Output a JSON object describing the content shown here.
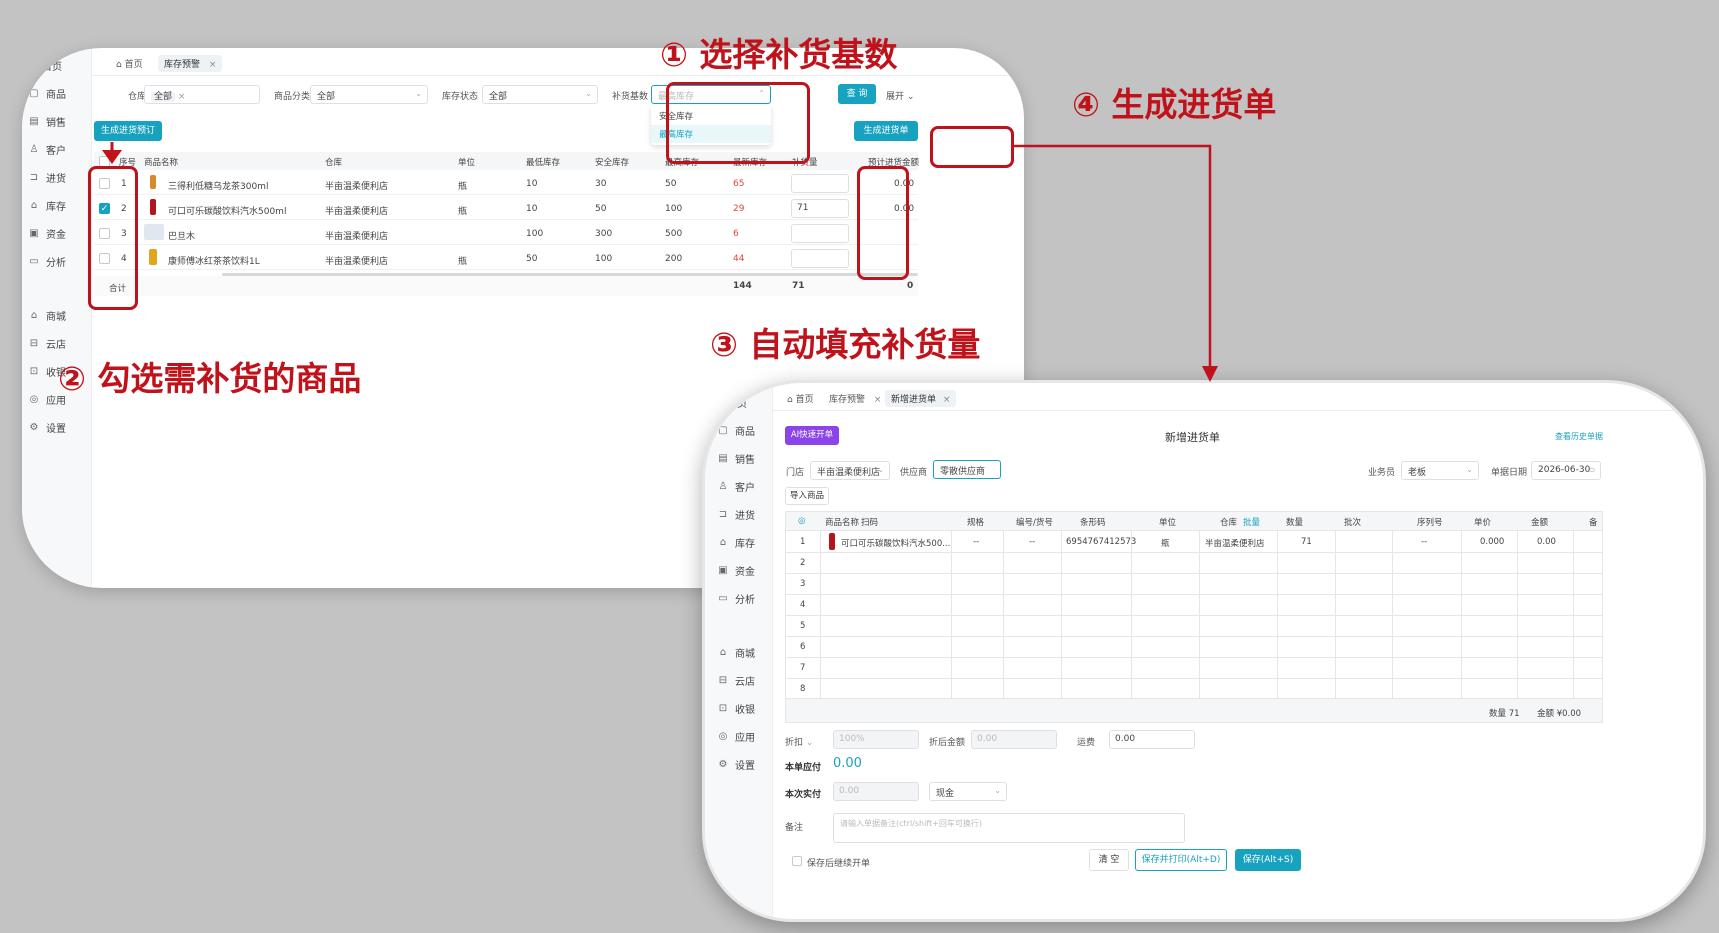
{
  "annotations": {
    "step1": "① 选择补货基数",
    "step2": "② 勾选需补货的商品",
    "step3": "③ 自动填充补货量",
    "step4": "④ 生成进货单"
  },
  "colors": {
    "accent": "#17a2c0",
    "annotation": "#c0121a",
    "warning": "#e0463a",
    "ai_button": "#8a44e8"
  },
  "sidebar": {
    "items": [
      {
        "label": "首页",
        "icon": "home-icon"
      },
      {
        "label": "商品",
        "icon": "box-icon"
      },
      {
        "label": "销售",
        "icon": "receipt-icon"
      },
      {
        "label": "客户",
        "icon": "user-icon"
      },
      {
        "label": "进货",
        "icon": "cart-icon"
      },
      {
        "label": "库存",
        "icon": "warehouse-icon"
      },
      {
        "label": "资金",
        "icon": "wallet-icon"
      },
      {
        "label": "分析",
        "icon": "chart-icon"
      },
      {
        "label": "商城",
        "icon": "shop-icon"
      },
      {
        "label": "云店",
        "icon": "cloud-store-icon"
      },
      {
        "label": "收银",
        "icon": "cashier-icon"
      },
      {
        "label": "应用",
        "icon": "apps-icon"
      },
      {
        "label": "设置",
        "icon": "gear-icon"
      }
    ]
  },
  "win1": {
    "tabs": [
      {
        "label": "首页"
      },
      {
        "label": "库存预警"
      }
    ],
    "filters": {
      "warehouse_label": "仓库",
      "warehouse_tag": "全部",
      "category_label": "商品分类",
      "category_value": "全部",
      "status_label": "库存状态",
      "status_value": "全部",
      "base_label": "补货基数",
      "base_placeholder": "最高库存",
      "base_options": [
        "安全库存",
        "最高库存"
      ],
      "query_btn": "查 询",
      "expand_btn": "展开"
    },
    "gen_forecast_btn": "生成进货预订",
    "gen_order_btn": "生成进货单",
    "columns": [
      "序号",
      "商品名称",
      "仓库",
      "单位",
      "最低库存",
      "安全库存",
      "最高库存",
      "最新库存",
      "补货量",
      "预计进货金额"
    ],
    "rows": [
      {
        "no": "1",
        "name": "三得利低糖乌龙茶300ml",
        "warehouse": "半亩温柔便利店",
        "unit": "瓶",
        "min": "10",
        "safe": "30",
        "max": "50",
        "stock": "65",
        "qty": "",
        "amount": "0.00"
      },
      {
        "no": "2",
        "name": "可口可乐碳酸饮料汽水500ml",
        "warehouse": "半亩温柔便利店",
        "unit": "瓶",
        "min": "10",
        "safe": "50",
        "max": "100",
        "stock": "29",
        "qty": "71",
        "amount": "0.00"
      },
      {
        "no": "3",
        "name": "巴旦木",
        "warehouse": "半亩温柔便利店",
        "unit": "",
        "min": "100",
        "safe": "300",
        "max": "500",
        "stock": "6",
        "qty": "",
        "amount": ""
      },
      {
        "no": "4",
        "name": "康师傅冰红茶茶饮料1L",
        "warehouse": "半亩温柔便利店",
        "unit": "瓶",
        "min": "50",
        "safe": "100",
        "max": "200",
        "stock": "44",
        "qty": "",
        "amount": ""
      }
    ],
    "total_label": "合计",
    "totals": {
      "stock": "144",
      "qty": "71",
      "amount": "0"
    }
  },
  "win2": {
    "tabs": [
      {
        "label": "首页"
      },
      {
        "label": "库存预警"
      },
      {
        "label": "新增进货单"
      }
    ],
    "ai_btn": "AI快速开单",
    "title": "新增进货单",
    "history_link": "查看历史单据",
    "store_label": "门店",
    "store_value": "半亩温柔便利店",
    "supplier_label": "供应商",
    "supplier_value": "零散供应商",
    "clerk_label": "业务员",
    "clerk_value": "老板",
    "date_label": "单据日期",
    "date_value": "2026-06-30",
    "import_btn": "导入商品",
    "columns": [
      "商品名称",
      "扫码",
      "规格",
      "编号/货号",
      "条形码",
      "单位",
      "仓库",
      "批量",
      "数量",
      "批次",
      "序列号",
      "单价",
      "金额",
      "备"
    ],
    "row": {
      "no": "1",
      "name": "可口可乐碳酸饮料汽水500...",
      "spec": "--",
      "code": "--",
      "barcode": "6954767412573",
      "unit": "瓶",
      "warehouse": "半亩温柔便利店",
      "qty": "71",
      "serial": "--",
      "price": "0.000",
      "amount": "0.00"
    },
    "row_numbers": [
      "2",
      "3",
      "4",
      "5",
      "6",
      "7",
      "8"
    ],
    "summary_qty": "数量 71",
    "summary_amount": "金额 ¥0.00",
    "discount_label": "折扣",
    "discount_value": "100%",
    "after_discount_label": "折后金额",
    "after_discount_value": "0.00",
    "freight_label": "运费",
    "freight_value": "0.00",
    "payable_label": "本单应付",
    "payable_value": "0.00",
    "paid_label": "本次实付",
    "paid_value": "0.00",
    "pay_method": "现金",
    "remark_label": "备注",
    "remark_placeholder": "请输入单据备注(ctrl/shift+回车可换行)",
    "continue_label": "保存后继续开单",
    "clear_btn": "清 空",
    "save_print_btn": "保存并打印(Alt+D)",
    "save_btn": "保存(Alt+S)"
  }
}
